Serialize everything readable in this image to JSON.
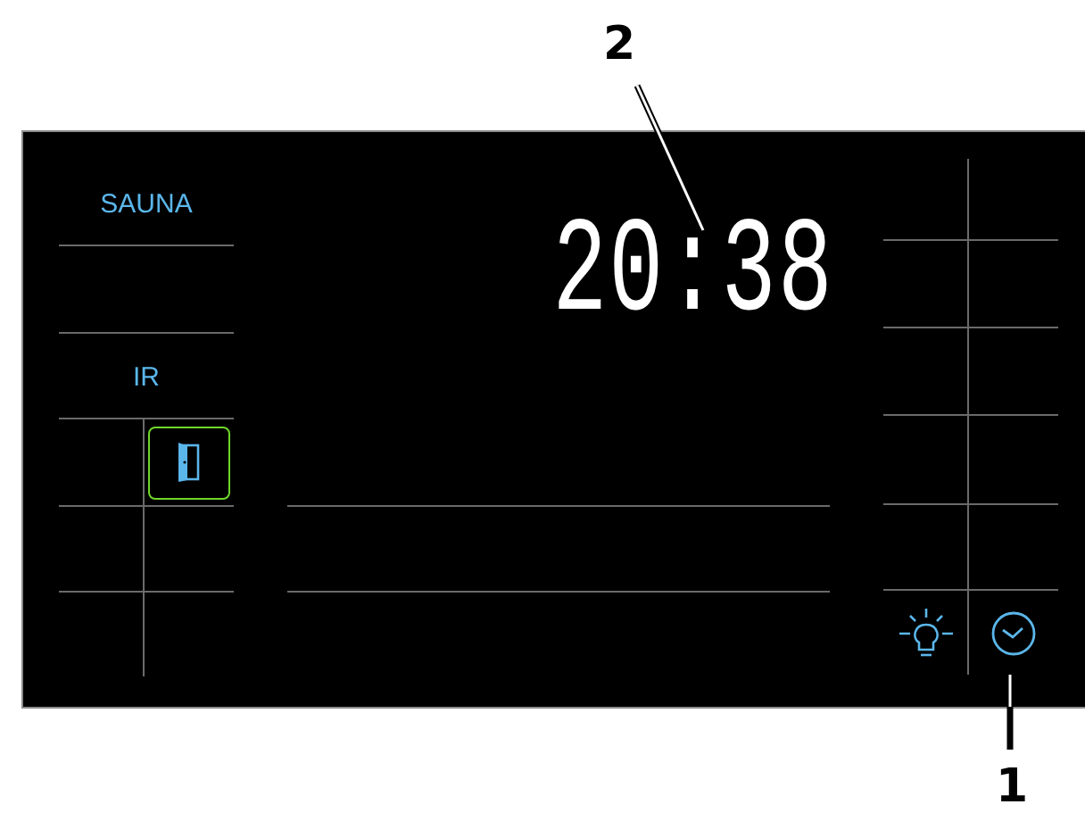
{
  "callouts": [
    {
      "label": "2"
    },
    {
      "label": "1"
    }
  ],
  "panel": {
    "modes": [
      {
        "label": "SAUNA"
      },
      {
        "label": "IR"
      }
    ],
    "door_button": {
      "active": true
    },
    "clock": {
      "time": "20:38"
    }
  }
}
